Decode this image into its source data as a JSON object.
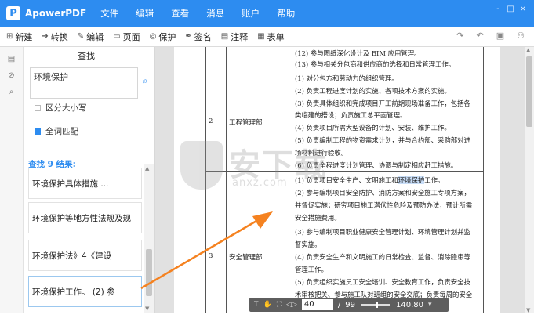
{
  "app": {
    "logo": "P",
    "name": "ApowerPDF"
  },
  "menu": [
    "文件",
    "编辑",
    "查看",
    "消息",
    "账户",
    "帮助"
  ],
  "window_controls": [
    "-",
    "□",
    "×"
  ],
  "toolbar": [
    {
      "icon": "⊞",
      "label": "新建"
    },
    {
      "icon": "➔",
      "label": "转换"
    },
    {
      "icon": "✎",
      "label": "编辑"
    },
    {
      "icon": "▭",
      "label": "页面"
    },
    {
      "icon": "◎",
      "label": "保护"
    },
    {
      "icon": "✒",
      "label": "签名"
    },
    {
      "icon": "▤",
      "label": "注释"
    },
    {
      "icon": "▦",
      "label": "表单"
    }
  ],
  "toolbar_right": [
    "↷",
    "↶",
    "▣",
    "⚇"
  ],
  "strip_icons": [
    "▤",
    "⊘",
    "⌕"
  ],
  "search": {
    "title": "查找",
    "query": "环境保护",
    "button": "⌕",
    "options": [
      {
        "label": "区分大小写",
        "checked": false
      },
      {
        "label": "全词匹配",
        "checked": true
      }
    ],
    "results_label": "查找 9 结果:",
    "results": [
      "环境保护具体措施 ...",
      "环境保护等地方性法规及规",
      "环境保护法》4《建设",
      "环境保护工作。 (2) 参"
    ]
  },
  "document": {
    "top_lines": [
      "(12) 参与图纸深化设计及 BIM 应用管理。",
      "(13) 参与相关分包商和供应商的选择和日常管理工作。"
    ],
    "rows": [
      {
        "number": "2",
        "dept": "工程管理部",
        "lines": [
          "(1) 对分包方和劳动力的组织管理。",
          "(2) 负责工程进度计划的实施、各项技术方案的实施。",
          "(3) 负责具体组织和完成项目开工前期现场准备工作，包括各",
          "类临建的搭设；负责施工总平面管理。",
          "(4) 负责项目所需大型设备的计划、安装、维护工作。",
          "(5) 负责编制工程的物资需求计划，并与合约部、采购部对进",
          "场材料进行验收。",
          "(6) 负责全程进度计划管理、协调与制定相应赶工措施。"
        ]
      },
      {
        "number": "3",
        "dept": "安全管理部",
        "lines": [
          "(1) 负责项目安全生产、文明施工和",
          "(2) 参与编制项目安全防护、消防方案和安全施工专项方案，",
          "并督促实施；研究项目施工潜伏性危险及预防办法，预计所需",
          "安全措施费用。",
          "(3) 参与编制项目职业健康安全管理计划、环境管理计划并监",
          "督实施。",
          "(4) 负责安全生产和文明施工的日常检查、监督、消除隐患等",
          "管理工作。",
          "(5) 负责组织实施员工安全培训、安全教育工作，负责安全技",
          "术审核把关、参与施工队对班组的安全交底；负责每周的安全"
        ],
        "highlight": "环境保护",
        "highlight_tail": "工作。"
      }
    ]
  },
  "watermark": {
    "big": "安下载",
    "small": "anxz.com"
  },
  "pager": {
    "tool_icons": [
      "T",
      "✋",
      "⛶",
      "◁▷"
    ],
    "current": "40",
    "separator": "/",
    "total": "99",
    "zoom": "140.80",
    "zoom_caret": "▾"
  },
  "colors": {
    "accent": "#2d8cf0",
    "arrow": "#f58220",
    "highlight": "#c9def8"
  }
}
